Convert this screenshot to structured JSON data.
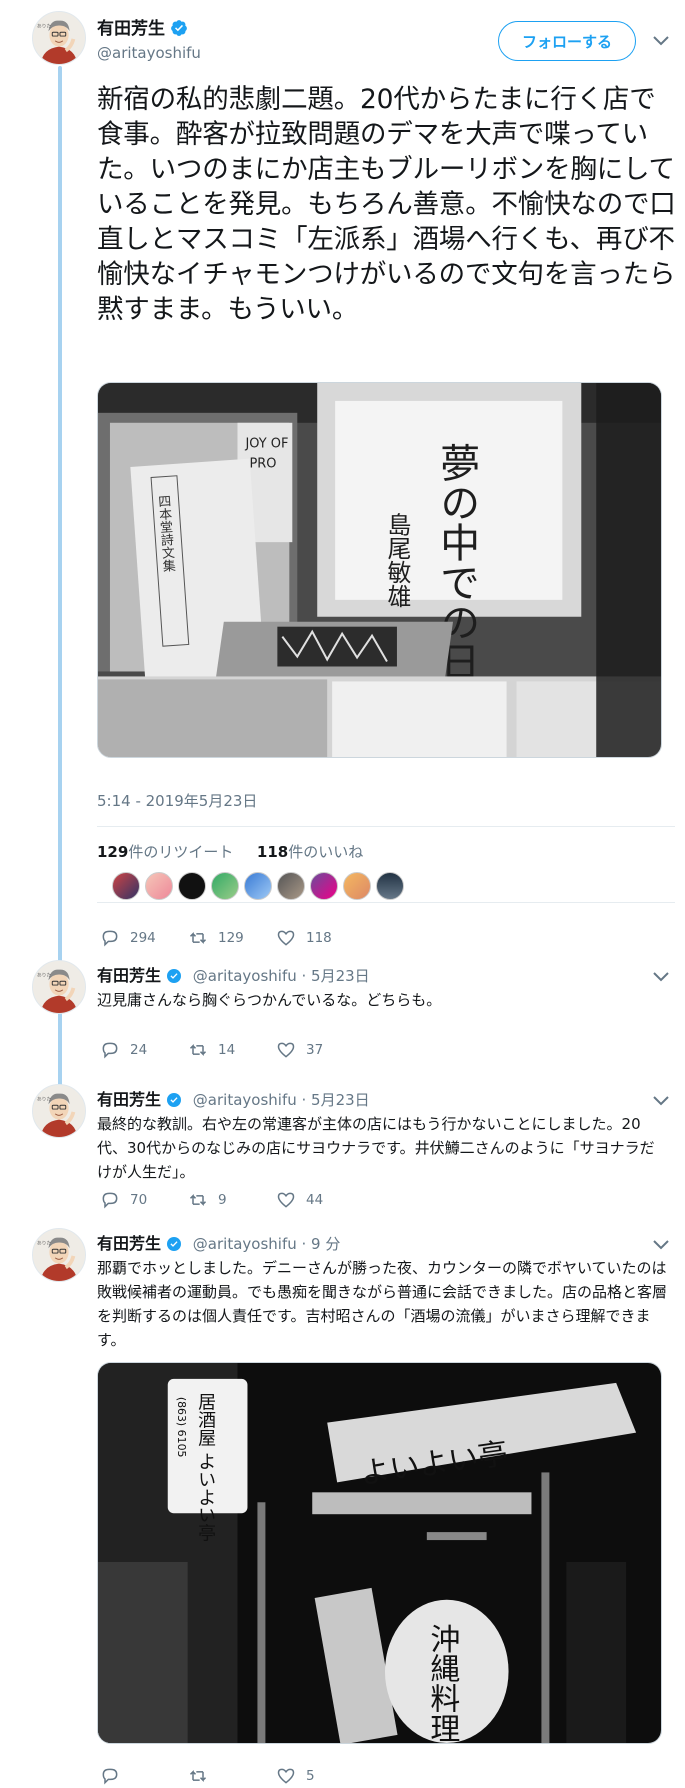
{
  "author": {
    "name": "有田芳生",
    "handle": "@aritayoshifu"
  },
  "follow_label": "フォローする",
  "main_tweet": {
    "text": "新宿の私的悲劇二題。20代からたまに行く店で食事。酔客が拉致問題のデマを大声で喋っていた。いつのまにか店主もブルーリボンを胸にしていることを発見。もちろん善意。不愉快なので口直しとマスコミ「左派系」酒場へ行くも、再び不愉快なイチャモンつけがいるので文句を言ったら黙すまま。もういい。",
    "timestamp": "5:14 - 2019年5月23日",
    "retweets_count": "129",
    "retweets_label": "件のリツイート",
    "likes_count": "118",
    "likes_label": "件のいいね",
    "replies": "294",
    "retweets": "129",
    "likes": "118",
    "photo": {
      "book_cover": "四本堂詩文集",
      "sign_title": "夢の中での日常",
      "sign_author": "島尾敏雄"
    }
  },
  "replies": [
    {
      "meta": "@aritayoshifu · 5月23日",
      "text": "辺見庸さんなら胸ぐらつかんでいるな。どちらも。",
      "replies": "24",
      "retweets": "14",
      "likes": "37"
    },
    {
      "meta": "@aritayoshifu · 5月23日",
      "text": "最終的な教訓。右や左の常連客が主体の店にはもう行かないことにしました。20代、30代からのなじみの店にサヨウナラです。井伏鱒二さんのように「サヨナラだけが人生だ」。",
      "replies": "70",
      "retweets": "9",
      "likes": "44"
    },
    {
      "meta": "@aritayoshifu · 9 分",
      "text": "那覇でホッとしました。デニーさんが勝った夜、カウンターの隣でボヤいていたのは敗戦候補者の運動員。でも愚痴を聞きながら普通に会話できました。店の品格と客層を判断するのは個人責任です。吉村昭さんの「酒場の流儀」がいまさら理解できます。",
      "replies": "",
      "retweets": "",
      "likes": "5",
      "photo": {
        "lantern_sign": "居酒屋 よいよい亭",
        "phone": "(863) 6105",
        "wood_sign": "よいよい亭",
        "lantern": "沖縄料理"
      }
    }
  ],
  "colors": {
    "accent": "#1da1f2",
    "thread_line": "#a7d2f0",
    "muted": "#657786"
  }
}
